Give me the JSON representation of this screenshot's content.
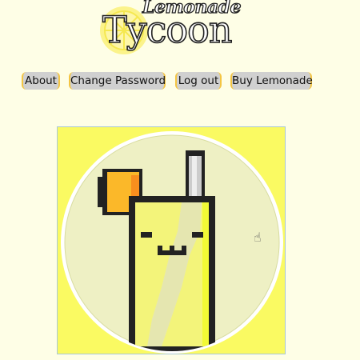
{
  "logo": {
    "line1": "Lemonade",
    "line2": "Tycoon"
  },
  "nav": {
    "about": "About",
    "change_password": "Change Password",
    "log_out": "Log out",
    "buy_lemonade": "Buy Lemonade"
  },
  "colors": {
    "background": "#fefee6",
    "button_bg": "#d0d0d0",
    "button_accent": "#f4c542",
    "avatar_bg": "#fafa62"
  }
}
